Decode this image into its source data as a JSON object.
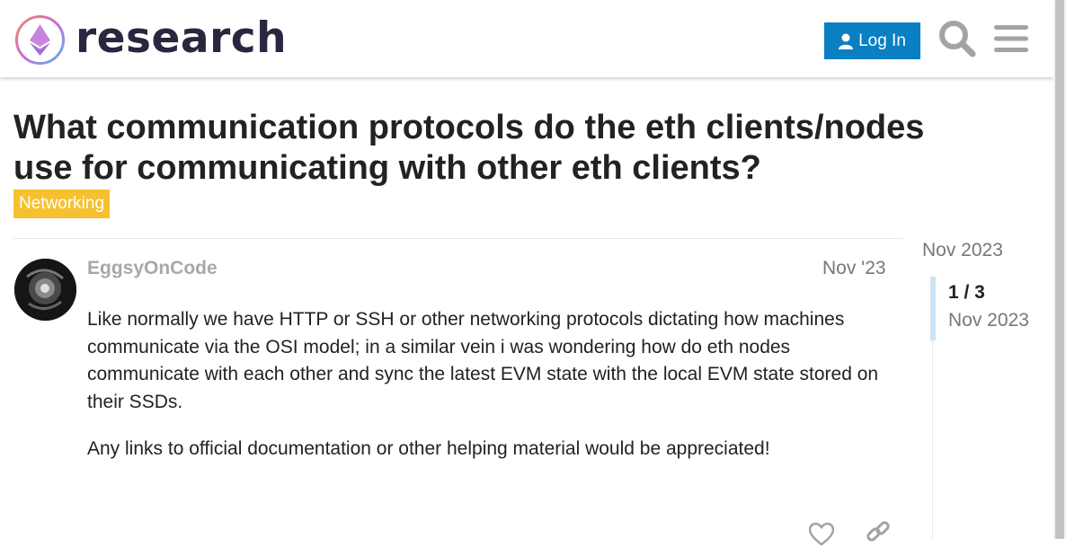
{
  "header": {
    "logo_text": "research",
    "login_label": "Log In",
    "icons": [
      "logo-icon",
      "user-icon",
      "search-icon",
      "hamburger-menu-icon"
    ]
  },
  "topic": {
    "title": "What communication protocols do the eth clients/nodes use for communicating with other eth clients?",
    "category": "Networking",
    "category_color": "#f7c02f"
  },
  "post": {
    "author": "EggsyOnCode",
    "date": "Nov '23",
    "paragraphs": [
      "Like normally we have HTTP or SSH or other networking protocols dictating how machines communicate via the OSI model; in a similar vein i was wondering how do eth nodes communicate with each other and sync the latest EVM state with the local EVM state stored on their SSDs.",
      "Any links to official documentation or other helping material would be appreciated!"
    ],
    "action_icons": [
      "heart-icon",
      "link-icon"
    ]
  },
  "timeline": {
    "top_date": "Nov 2023",
    "counter": "1 / 3",
    "current_date": "Nov 2023"
  },
  "colors": {
    "accent": "#0a7fc2",
    "category": "#f7c02f",
    "muted_text": "#777777"
  }
}
